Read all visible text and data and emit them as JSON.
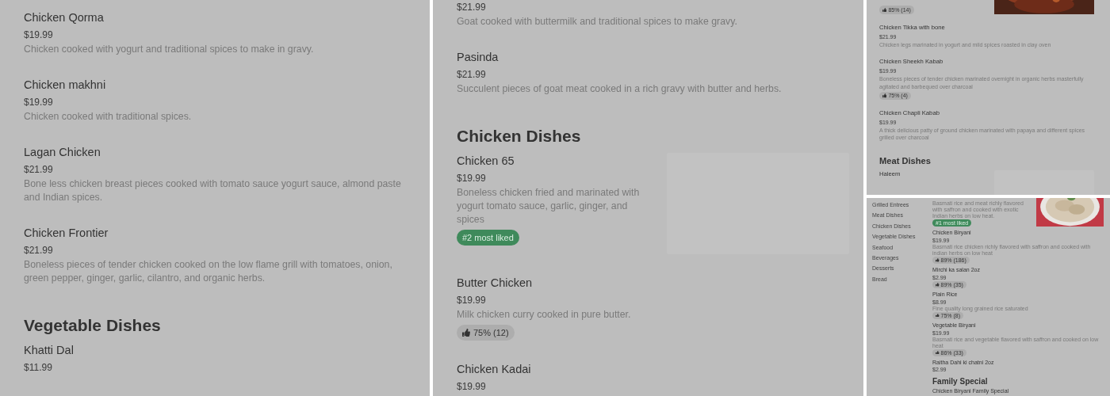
{
  "panels": [
    {
      "entries": [
        {
          "kind": "dish",
          "name": "Chicken Qorma",
          "price": "$19.99",
          "description": "Chicken cooked with yogurt and traditional spices to make in gravy."
        },
        {
          "kind": "dish",
          "name": "Chicken makhni",
          "price": "$19.99",
          "description": "Chicken cooked with traditional spices."
        },
        {
          "kind": "dish",
          "name": "Lagan Chicken",
          "price": "$21.99",
          "description": "Bone less chicken breast pieces cooked with tomato sauce yogurt sauce, almond paste and Indian spices."
        },
        {
          "kind": "dish",
          "name": "Chicken Frontier",
          "price": "$21.99",
          "description": "Boneless pieces of tender chicken cooked on the low flame grill with tomatoes, onion, green pepper, ginger, garlic, cilantro, and organic herbs."
        },
        {
          "kind": "section",
          "title": "Vegetable Dishes"
        },
        {
          "kind": "dish",
          "name": "Khatti Dal",
          "price": "$11.99"
        }
      ]
    },
    {
      "entries": [
        {
          "kind": "dish",
          "price": "$21.99",
          "description": "Goat cooked with buttermilk and traditional spices to make gravy."
        },
        {
          "kind": "dish",
          "name": "Pasinda",
          "price": "$21.99",
          "description": "Succulent pieces of goat meat cooked in a rich gravy with butter and herbs."
        },
        {
          "kind": "section",
          "title": "Chicken Dishes"
        },
        {
          "kind": "dish",
          "name": "Chicken 65",
          "price": "$19.99",
          "description": "Boneless chicken fried and marinated with yogurt tomato sauce, garlic, ginger, and spices",
          "badge": {
            "kind": "liked",
            "text": "#2 most liked"
          },
          "image": {
            "kind": "placeholder"
          }
        },
        {
          "kind": "dish",
          "name": "Butter Chicken",
          "price": "$19.99",
          "description": "Milk chicken curry cooked in pure butter.",
          "badge": {
            "kind": "rating",
            "text": "75% (12)"
          }
        },
        {
          "kind": "dish",
          "name": "Chicken Kadai",
          "price": "$19.99"
        }
      ]
    },
    {
      "entries": [
        {
          "kind": "dish",
          "badge": {
            "kind": "rating",
            "text": "85% (14)"
          }
        },
        {
          "kind": "dish",
          "name": "Chicken Tikka with bone",
          "price": "$21.99",
          "description": "Chicken legs marinated in yogurt and mild spices roasted in clay oven"
        },
        {
          "kind": "dish",
          "name": "Chicken Sheekh Kabab",
          "price": "$19.99",
          "description": "Boneless pieces of tender chicken marinated overnight in organic herbs masterfully agitated and barbequed over charcoal",
          "badge": {
            "kind": "rating",
            "text": "75% (4)"
          }
        },
        {
          "kind": "dish",
          "name": "Chicken Chapli Kabab",
          "price": "$19.99",
          "description": "A thick delicious patty of ground chicken marinated with papaya and different spices grilled over charcoal"
        },
        {
          "kind": "section",
          "title": "Meat Dishes"
        },
        {
          "kind": "dish",
          "name": "Haleem",
          "image": {
            "kind": "placeholder"
          }
        }
      ]
    },
    {
      "nav": [
        "Grilled Entrees",
        "Meat Dishes",
        "Chicken Dishes",
        "Vegetable Dishes",
        "Seafood",
        "Beverages",
        "Desserts",
        "Bread"
      ],
      "entries": [
        {
          "kind": "dish",
          "description": "Basmati rice and meat richly flavored with saffron and cooked with exotic Indian herbs on low heat.",
          "badge": {
            "kind": "liked",
            "text": "#1 most liked"
          }
        },
        {
          "kind": "dish",
          "name": "Chicken Biryani",
          "price": "$19.99",
          "description": "Basmati rice chicken richly flavored with saffron and cooked with indian herbs on low heat",
          "badge": {
            "kind": "rating",
            "text": "89% (186)"
          }
        },
        {
          "kind": "dish",
          "name": "Mirchi ka salan 2oz",
          "price": "$2.99",
          "badge": {
            "kind": "rating",
            "text": "89% (35)"
          }
        },
        {
          "kind": "dish",
          "name": "Plain Rice",
          "price": "$8.99",
          "description": "Fine quality long grained rice saturated",
          "badge": {
            "kind": "rating",
            "text": "75% (8)"
          }
        },
        {
          "kind": "dish",
          "name": "Vegetable Biryani",
          "price": "$19.99",
          "description": "Basmati rice and vegetable flavored with saffron and cooked on low heat",
          "badge": {
            "kind": "rating",
            "text": "86% (33)"
          }
        },
        {
          "kind": "dish",
          "name": "Raitha Dahi ki chatni 2oz",
          "price": "$2.99"
        },
        {
          "kind": "section",
          "title": "Family Special"
        },
        {
          "kind": "dish",
          "name": "Chicken Biryani Family Special"
        }
      ]
    }
  ]
}
